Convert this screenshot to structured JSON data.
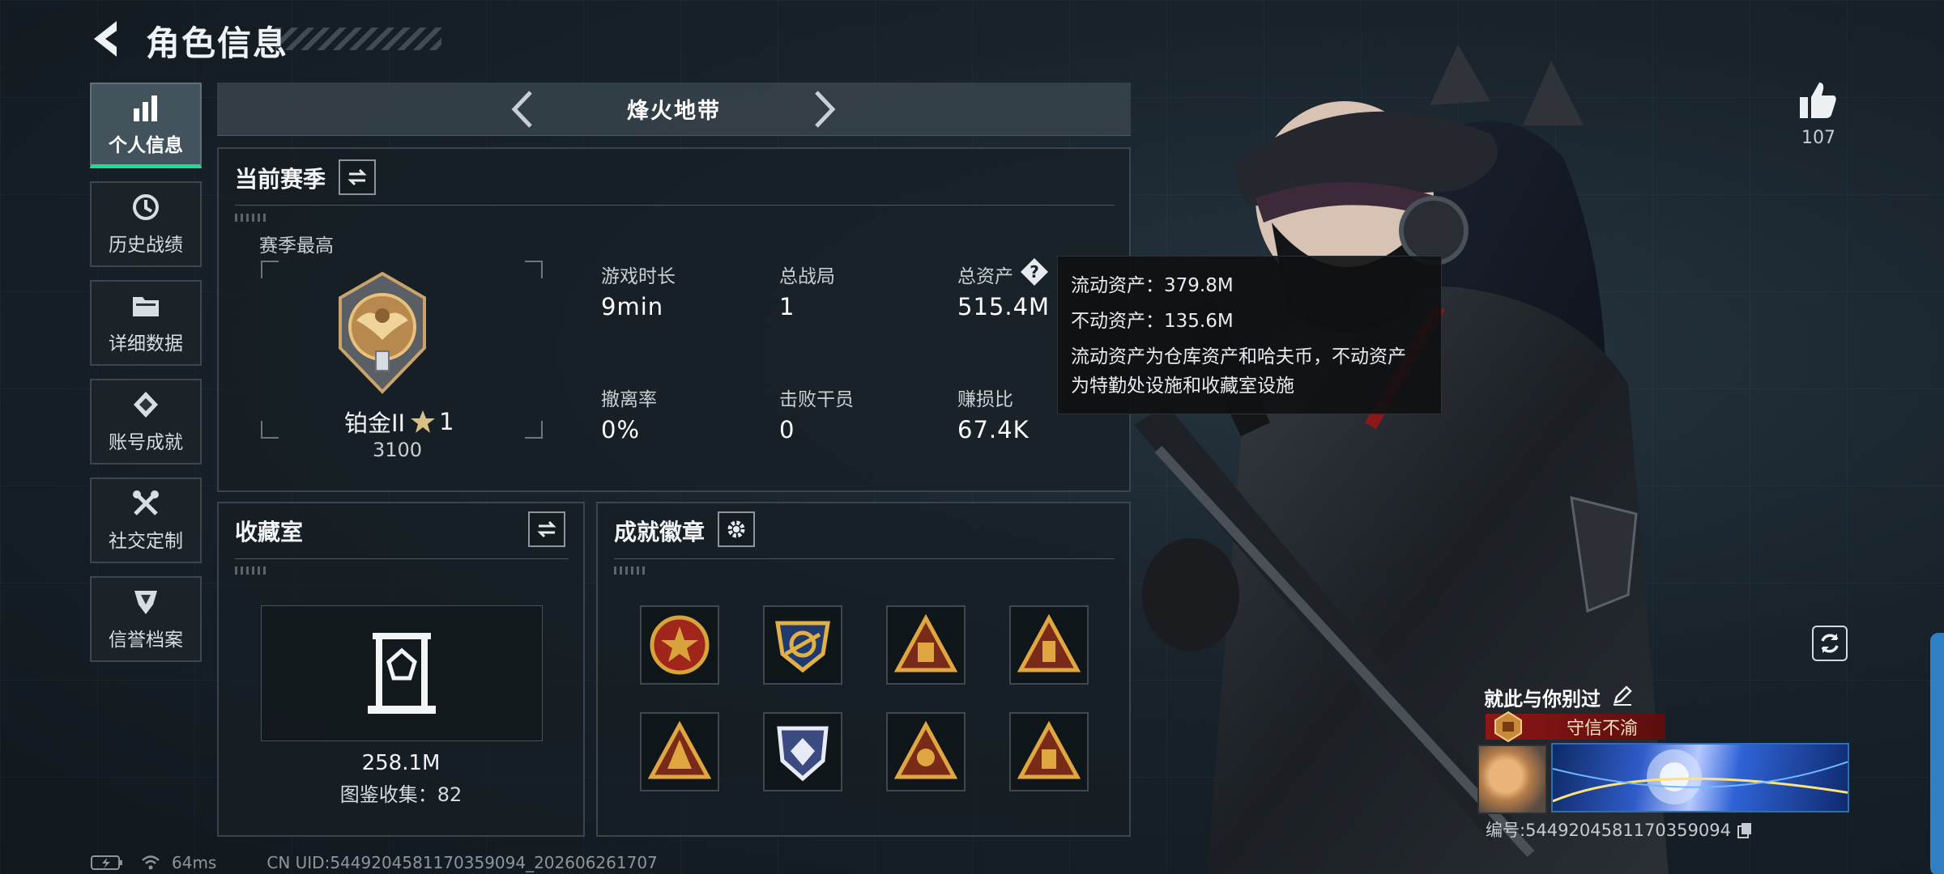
{
  "header": {
    "title": "角色信息"
  },
  "nav": {
    "items": [
      {
        "label": "个人信息",
        "icon": "bar-chart-icon"
      },
      {
        "label": "历史战绩",
        "icon": "history-clock-icon"
      },
      {
        "label": "详细数据",
        "icon": "folder-icon"
      },
      {
        "label": "账号成就",
        "icon": "achievement-icon"
      },
      {
        "label": "社交定制",
        "icon": "tools-icon"
      },
      {
        "label": "信誉档案",
        "icon": "credit-shield-icon"
      }
    ]
  },
  "mode": {
    "label": "烽火地带"
  },
  "season": {
    "title": "当前赛季",
    "best_label": "赛季最高",
    "rank_name": "铂金II",
    "rank_stars": "1",
    "rank_score": "3100",
    "stats": [
      {
        "label": "游戏时长",
        "value": "9min"
      },
      {
        "label": "总战局",
        "value": "1"
      },
      {
        "label": "总资产",
        "value": "515.4M"
      },
      {
        "label": "撤离率",
        "value": "0%"
      },
      {
        "label": "击败干员",
        "value": "0"
      },
      {
        "label": "赚损比",
        "value": "67.4K"
      }
    ]
  },
  "tooltip": {
    "liquid": "流动资产：379.8M",
    "fixed": "不动资产：135.6M",
    "desc_line1": "流动资产为仓库资产和哈夫币，不动资产",
    "desc_line2": "为特勤处设施和收藏室设施"
  },
  "collection": {
    "title": "收藏室",
    "value": "258.1M",
    "count_text": "图鉴收集：82"
  },
  "badges": {
    "title": "成就徽章",
    "items": [
      {
        "name": "star-shield-badge",
        "colors": [
          "#a0261c",
          "#d6a43a"
        ]
      },
      {
        "name": "eagle-shield-badge",
        "colors": [
          "#1f3a6e",
          "#e2b045"
        ]
      },
      {
        "name": "triangle-gold-badge-1",
        "colors": [
          "#7a2a18",
          "#e0a640"
        ]
      },
      {
        "name": "triangle-gold-badge-2",
        "colors": [
          "#7a2a18",
          "#e0a640"
        ]
      },
      {
        "name": "triangle-gold-badge-3",
        "colors": [
          "#7a2a18",
          "#e0a640"
        ]
      },
      {
        "name": "diamond-shield-badge",
        "colors": [
          "#3c4a82",
          "#e6ebf5"
        ]
      },
      {
        "name": "triangle-gold-badge-4",
        "colors": [
          "#7a2a18",
          "#e0a640"
        ]
      },
      {
        "name": "triangle-gold-badge-5",
        "colors": [
          "#7a2a18",
          "#e0a640"
        ]
      }
    ]
  },
  "social": {
    "likes": "107"
  },
  "profile": {
    "signature": "就此与你别过",
    "credit_tag": "守信不渝",
    "uid_text": "编号:5449204581170359094"
  },
  "status": {
    "ping": "64ms",
    "uid": "CN UID:5449204581170359094_202606261707"
  },
  "colors": {
    "accent": "#1fdc8e",
    "panel_border": "#39444c",
    "credit_red": "#8e1616"
  }
}
